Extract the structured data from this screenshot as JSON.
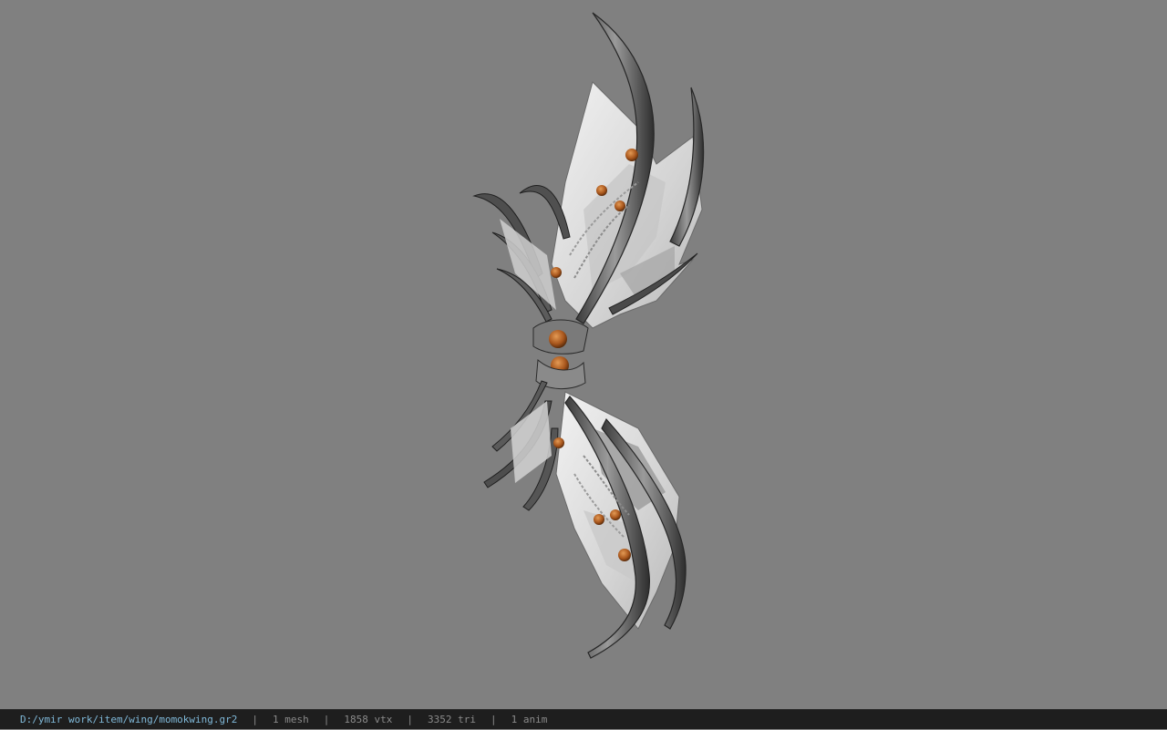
{
  "viewport": {
    "background": "#808080",
    "model_icon": "wing-model-render"
  },
  "status_bar": {
    "file_path": "D:/ymir work/item/wing/momokwing.gr2",
    "separator": "|",
    "mesh_count": "1 mesh",
    "vertex_count": "1858 vtx",
    "triangle_count": "3352 tri",
    "anim_count": "1 anim",
    "path_color": "#7fb8d8",
    "text_color": "#8a8a8a",
    "bar_color": "#1e1e1e"
  }
}
